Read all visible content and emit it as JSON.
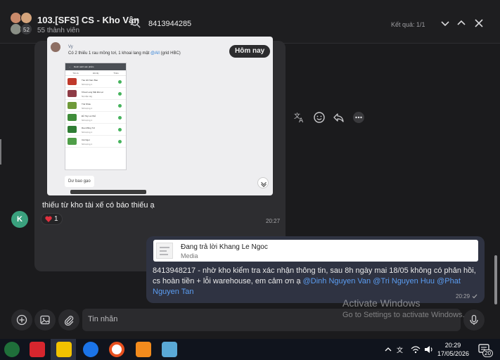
{
  "header": {
    "group_name": "103.[SFS] CS - Kho Vận",
    "member_count": "55 thành viên",
    "avatar_overflow": "52",
    "search_value": "8413944285",
    "result_count": "Kết quả: 1/1"
  },
  "shared_image": {
    "today_label": "Hôm nay",
    "quote_name": "Vy",
    "quote_text": "Có  2 thiếu 1 rau mồng tơi, 1 khoai lang mật",
    "quote_mention": "@All",
    "quote_suffix": "(grid HBC)",
    "phone_title": "Danh sách sản phẩm",
    "phone_tabs": [
      "Tất cả",
      "Đã lấy",
      "Thiếu"
    ],
    "products": [
      {
        "name": "Táo Hồ Nam Bao",
        "qty": "Số lượng 1"
      },
      {
        "name": "Khoai Lang Mật Đà Lạt",
        "qty": "Nội địa 1kg"
      },
      {
        "name": "Trái Nhàu",
        "qty": "Số lượng 1"
      },
      {
        "name": "Đỗ Tây Lá Nhỏ",
        "qty": "Số lượng 1"
      },
      {
        "name": "Rau Mồng Tơi",
        "qty": "Số lượng 1"
      },
      {
        "name": "Cải Ngọt",
        "qty": "Số lượng 1"
      }
    ],
    "caption": "Dư bao gạo"
  },
  "message1": {
    "text": "thiếu từ kho tài xế có báo thiếu ạ",
    "sender_initial": "K",
    "reaction_count": "1",
    "time": "20:27"
  },
  "message2": {
    "reply_title": "Đang trả lời Khang Le Ngoc",
    "reply_sub": "Media",
    "text": "8413948217 - nhờ kho kiểm tra xác nhận thông tin, sau  8h ngày mai 18/05 không có phản hồi, cs hoàn tiền + lỗi warehouse, em cảm ơn ạ",
    "mention1": "@Dinh Nguyen Van",
    "mention2": "@Tri Nguyen Huu",
    "mention3": "@Phat Nguyen Tan",
    "time": "20:29"
  },
  "composer": {
    "placeholder": "Tin nhắn"
  },
  "watermark": {
    "line1": "Activate Windows",
    "line2": "Go to Settings to activate Windows."
  },
  "taskbar": {
    "time": "20:29",
    "date": "17/05/2026",
    "notification_count": "20"
  },
  "colors": {
    "accent": "#5b9df2",
    "own_bubble": "#2f3342",
    "other_bubble": "#2d2d30"
  }
}
